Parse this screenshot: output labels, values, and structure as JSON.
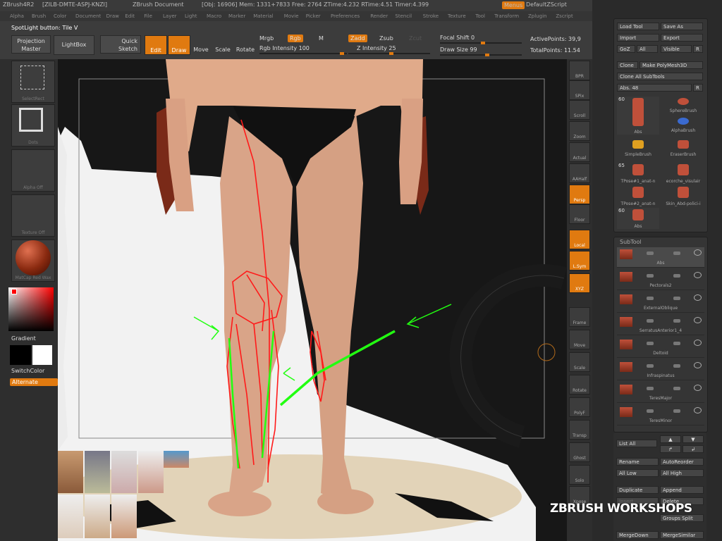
{
  "titlebar": {
    "app": "ZBrush4R2",
    "license": "[ZILB-DMTE-ASPJ-KNZI]",
    "document": "ZBrush Document",
    "stats": "[Obj: 16906] Mem: 1331+7833 Free: 2764 ZTime:4.232 RTime:4.51 Timer:4.399",
    "menus_btn": "Menus",
    "script": "DefaultZScript"
  },
  "menubar": [
    "Alpha",
    "Brush",
    "Color",
    "Document",
    "Draw",
    "Edit",
    "File",
    "Layer",
    "Light",
    "Macro",
    "Marker",
    "Material",
    "Movie",
    "Picker",
    "Preferences",
    "Render",
    "Stencil",
    "Stroke",
    "Texture",
    "Tool",
    "Transform",
    "Zplugin",
    "Zscript"
  ],
  "toolbar": {
    "spotlight": "SpotLight button: Tile V",
    "projection": "Projection Master",
    "lightbox": "LightBox",
    "quicksketch": "Quick Sketch",
    "edit": "Edit",
    "draw": "Draw",
    "move": "Move",
    "scale": "Scale",
    "rotate": "Rotate",
    "mrgb": "Mrgb",
    "rgb": "Rgb",
    "m": "M",
    "rgb_intensity": "Rgb Intensity 100",
    "zadd": "Zadd",
    "zsub": "Zsub",
    "zcut": "Zcut",
    "z_intensity": "Z Intensity 25",
    "focal_shift": "Focal Shift 0",
    "draw_size": "Draw Size 99",
    "active_points": "ActivePoints: 39,9",
    "total_points": "TotalPoints: 11.54"
  },
  "left_shelf": {
    "tiles": [
      "SelectRect",
      "Dots",
      "Alpha Off",
      "Texture Off",
      "MatCap Red Wax"
    ],
    "gradient": "Gradient",
    "switchcolor": "SwitchColor",
    "alternate": "Alternate"
  },
  "right_shelf": [
    "BPR",
    "SPix",
    "Scroll",
    "Zoom",
    "Actual",
    "AAHalf",
    "Persp",
    "Floor",
    "Local",
    "L.Sym",
    "XYZ",
    "Frame",
    "Move",
    "Scale",
    "Rotate",
    "PolyF",
    "Transp",
    "Ghost",
    "Solo",
    "Xpose"
  ],
  "tool_panel": {
    "load_tool": "Load Tool",
    "save_as": "Save As",
    "import": "Import",
    "export": "Export",
    "goz": "GoZ",
    "all": "All",
    "visible": "Visible",
    "r": "R",
    "clone": "Clone",
    "make_polymesh": "Make PolyMesh3D",
    "clone_all": "Clone All SubTools",
    "abs_value": "Abs. 48",
    "r2": "R",
    "tools": [
      {
        "name": "Abs",
        "count": "60"
      },
      {
        "name": "SphereBrush",
        "count": ""
      },
      {
        "name": "AlphaBrush",
        "count": ""
      },
      {
        "name": "SimpleBrush",
        "count": ""
      },
      {
        "name": "EraserBrush",
        "count": ""
      },
      {
        "name": "TPose#1_anat-n",
        "count": "65"
      },
      {
        "name": "ecorche_visulair",
        "count": ""
      },
      {
        "name": "TPose#2_anat-n",
        "count": ""
      },
      {
        "name": "Skin_Abd-polici-i",
        "count": ""
      },
      {
        "name": "Abs",
        "count": "60"
      }
    ]
  },
  "subtool": {
    "title": "SubTool",
    "items": [
      "Abs",
      "Pectorals2",
      "ExternalOblique",
      "SerratusAnterior1_4",
      "Deltoid",
      "Infraspinatus",
      "TeresMajor",
      "TeresMinor"
    ]
  },
  "bottom_panel": {
    "list_all": "List All",
    "rename": "Rename",
    "autoreorder": "AutoReorder",
    "all_low": "All Low",
    "all_high": "All High",
    "duplicate": "Duplicate",
    "append": "Append",
    "insert": "Insert",
    "delete": "Delete",
    "groups_split": "Groups Split",
    "mergedown": "MergeDown",
    "mergesimilar": "MergeSimilar"
  },
  "watermark": "ZBRUSH WORKSHOPS",
  "colors": {
    "accent": "#e07a10",
    "panel": "#353535",
    "stroke_red": "#ff1a1a",
    "stroke_green": "#22ff11"
  }
}
